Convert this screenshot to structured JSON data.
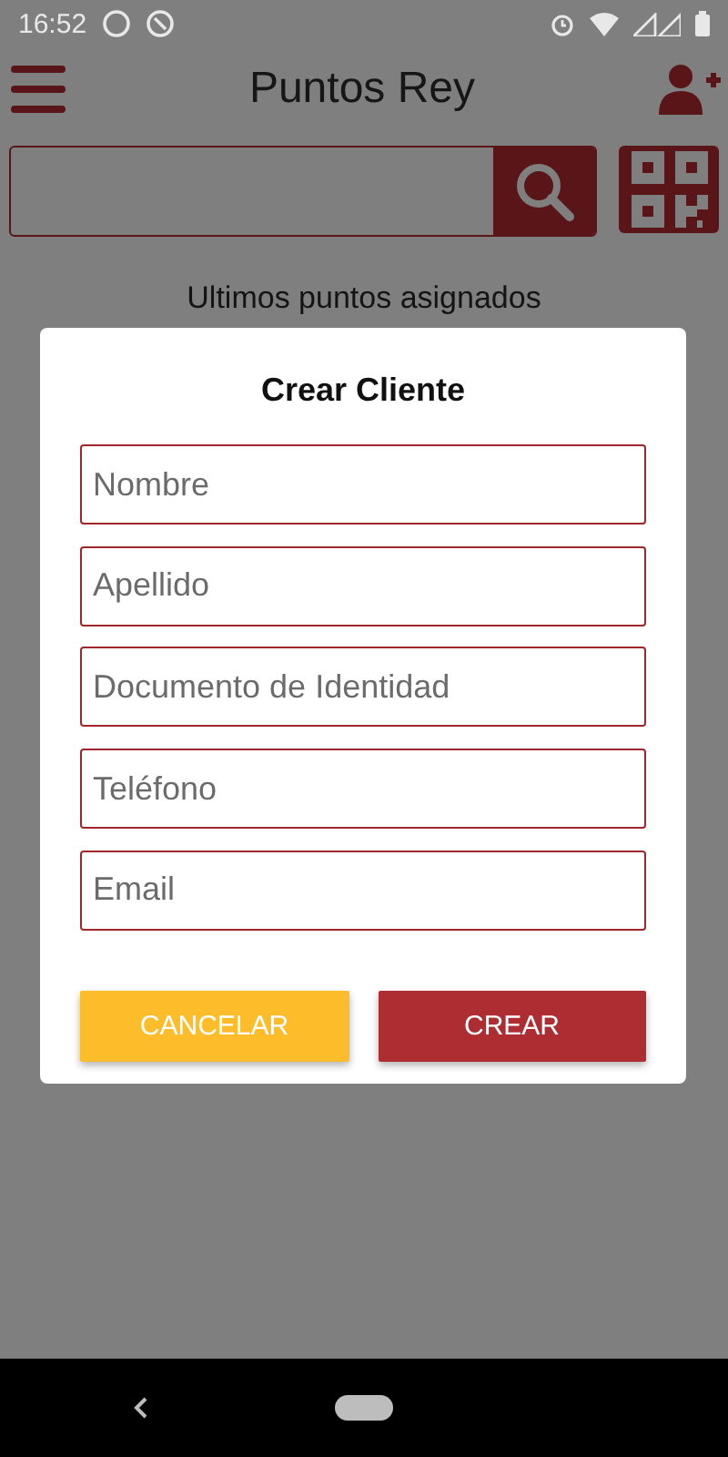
{
  "status_bar": {
    "time": "16:52"
  },
  "header": {
    "title": "Puntos Rey"
  },
  "section_title": "Ultimos puntos asignados",
  "dialog": {
    "title": "Crear Cliente",
    "fields": [
      {
        "placeholder": "Nombre"
      },
      {
        "placeholder": "Apellido"
      },
      {
        "placeholder": "Documento de Identidad"
      },
      {
        "placeholder": "Teléfono"
      },
      {
        "placeholder": "Email"
      }
    ],
    "buttons": [
      {
        "label": "CANCELAR",
        "kind": "secondary"
      },
      {
        "label": "CREAR",
        "kind": "primary"
      }
    ]
  }
}
